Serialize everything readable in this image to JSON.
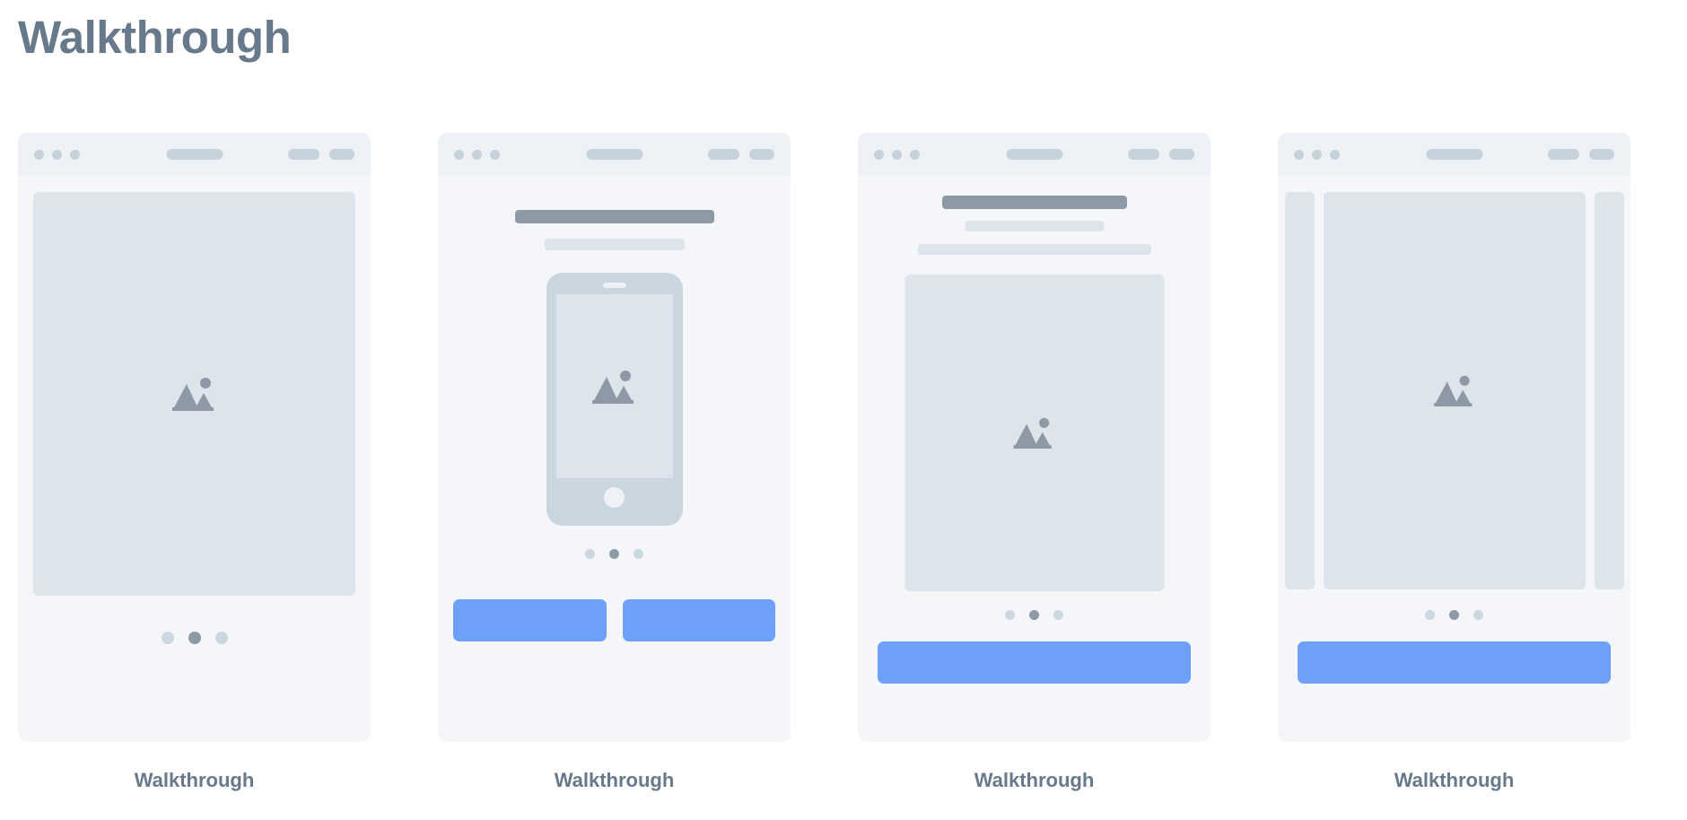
{
  "page": {
    "title": "Walkthrough",
    "background_color": "#ffffff",
    "title_color": "#67798a"
  },
  "palette": {
    "card_background": "#f4f6f9",
    "chrome_background": "#eef1f5",
    "chrome_element": "#c5d2dc",
    "skeleton_light": "#dde4eb",
    "skeleton_dark": "#8d9aa6",
    "icon_color": "#8d9aa6",
    "dot_inactive": "#ccd8e1",
    "dot_active": "#8d9aa6",
    "button_blue": "#6d9ffb",
    "caption_color": "#67798a"
  },
  "chrome": {
    "traffic_dots": 3,
    "center_pill": "url-bar",
    "right_pills": [
      "control-pill-1",
      "control-pill-2"
    ]
  },
  "icons": {
    "image_placeholder": "image-mountain-icon",
    "phone": "phone-mockup-icon"
  },
  "cards": [
    {
      "id": "card-1",
      "caption": "Walkthrough",
      "layout": "full-bleed-image",
      "pagination": {
        "total": 3,
        "active_index": 1
      },
      "buttons": []
    },
    {
      "id": "card-2",
      "caption": "Walkthrough",
      "layout": "phone-mockup-with-two-buttons",
      "headline_bar": "title-placeholder",
      "subtitle_bar": "subtitle-placeholder",
      "pagination": {
        "total": 3,
        "active_index": 1
      },
      "buttons": [
        "secondary-action",
        "primary-action"
      ]
    },
    {
      "id": "card-3",
      "caption": "Walkthrough",
      "layout": "text-image-single-button",
      "headline_bar": "title-placeholder",
      "subtitle_bars": [
        "subtitle-line-1",
        "subtitle-line-2"
      ],
      "pagination": {
        "total": 3,
        "active_index": 1
      },
      "buttons": [
        "primary-action"
      ]
    },
    {
      "id": "card-4",
      "caption": "Walkthrough",
      "layout": "carousel-single-button",
      "carousel": {
        "peek_left": true,
        "peek_right": true
      },
      "pagination": {
        "total": 3,
        "active_index": 1
      },
      "buttons": [
        "primary-action"
      ]
    }
  ]
}
